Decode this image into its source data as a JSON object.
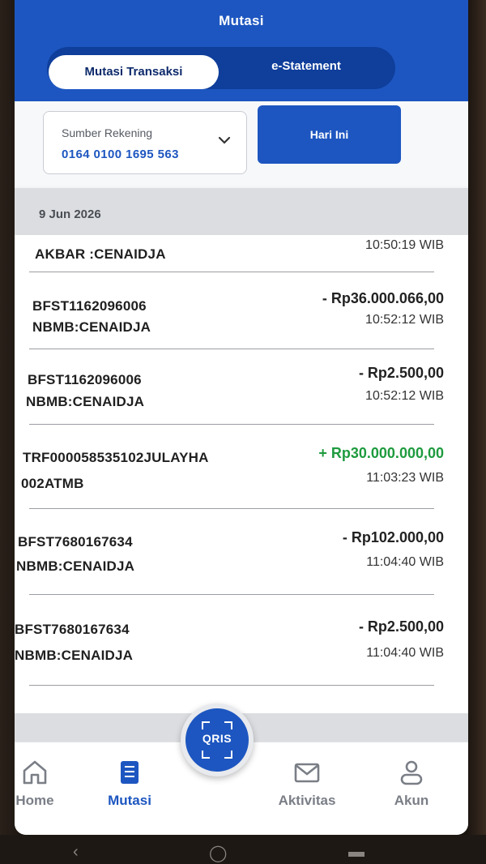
{
  "header": {
    "title": "Mutasi",
    "tabs": [
      {
        "label": "Mutasi Transaksi",
        "active": true
      },
      {
        "label": "e-Statement",
        "active": false
      }
    ]
  },
  "filter": {
    "account_label": "Sumber Rekening",
    "account_number": "0164 0100 1695 563",
    "period_button": "Hari Ini"
  },
  "date_header": "9 Jun 2026",
  "transactions": [
    {
      "line1": "AKBAR :CENAIDJA",
      "line2": "",
      "amount": "",
      "type": "none",
      "time": "10:50:19 WIB"
    },
    {
      "line1": "BFST1162096006",
      "line2": "NBMB:CENAIDJA",
      "amount": "- Rp36.000.066,00",
      "type": "debit",
      "time": "10:52:12 WIB"
    },
    {
      "line1": "BFST1162096006",
      "line2": "NBMB:CENAIDJA",
      "amount": "- Rp2.500,00",
      "type": "debit",
      "time": "10:52:12 WIB"
    },
    {
      "line1": "TRF000058535102JULAYHA",
      "line2": "002ATMB",
      "amount": "+ Rp30.000.000,00",
      "type": "credit",
      "time": "11:03:23 WIB"
    },
    {
      "line1": "BFST7680167634",
      "line2": "NBMB:CENAIDJA",
      "amount": "- Rp102.000,00",
      "type": "debit",
      "time": "11:04:40 WIB"
    },
    {
      "line1": "BFST7680167634",
      "line2": "NBMB:CENAIDJA",
      "amount": "- Rp2.500,00",
      "type": "debit",
      "time": "11:04:40 WIB"
    }
  ],
  "bottom_nav": {
    "items": [
      {
        "label": "Home",
        "icon": "home-icon",
        "active": false
      },
      {
        "label": "Mutasi",
        "icon": "receipt-icon",
        "active": true
      },
      {
        "label": "Aktivitas",
        "icon": "mail-icon",
        "active": false
      },
      {
        "label": "Akun",
        "icon": "user-icon",
        "active": false
      }
    ],
    "qris_label": "QRIS"
  },
  "colors": {
    "primary": "#1d56c0",
    "credit": "#1e9b3e",
    "debit": "#222222"
  }
}
